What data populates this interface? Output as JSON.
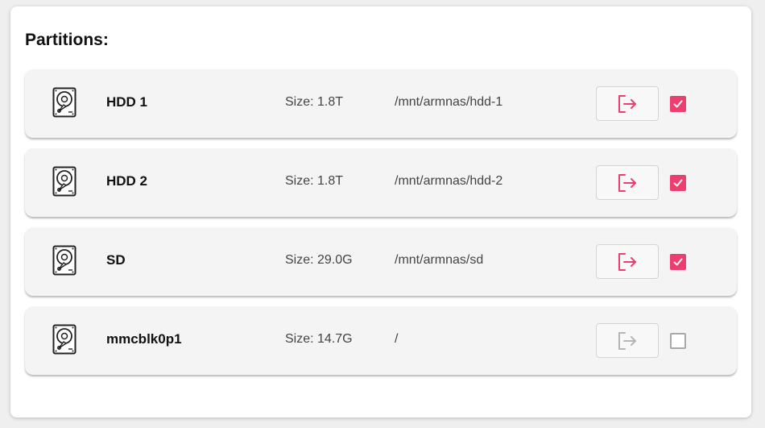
{
  "page": {
    "title": "Partitions:"
  },
  "colors": {
    "accent": "#ec3f6f",
    "disabled": "#b5b5b5"
  },
  "partitions": [
    {
      "name": "HDD 1",
      "size": "Size: 1.8T",
      "mount": "/mnt/armnas/hdd-1",
      "checked": true,
      "eject_enabled": true,
      "icon": "hard-drive-icon",
      "eject_icon": "eject-icon"
    },
    {
      "name": "HDD 2",
      "size": "Size: 1.8T",
      "mount": "/mnt/armnas/hdd-2",
      "checked": true,
      "eject_enabled": true,
      "icon": "hard-drive-icon",
      "eject_icon": "eject-icon"
    },
    {
      "name": "SD",
      "size": "Size: 29.0G",
      "mount": "/mnt/armnas/sd",
      "checked": true,
      "eject_enabled": true,
      "icon": "hard-drive-icon",
      "eject_icon": "eject-icon"
    },
    {
      "name": "mmcblk0p1",
      "size": "Size: 14.7G",
      "mount": "/",
      "checked": false,
      "eject_enabled": false,
      "icon": "hard-drive-icon",
      "eject_icon": "eject-icon"
    }
  ]
}
